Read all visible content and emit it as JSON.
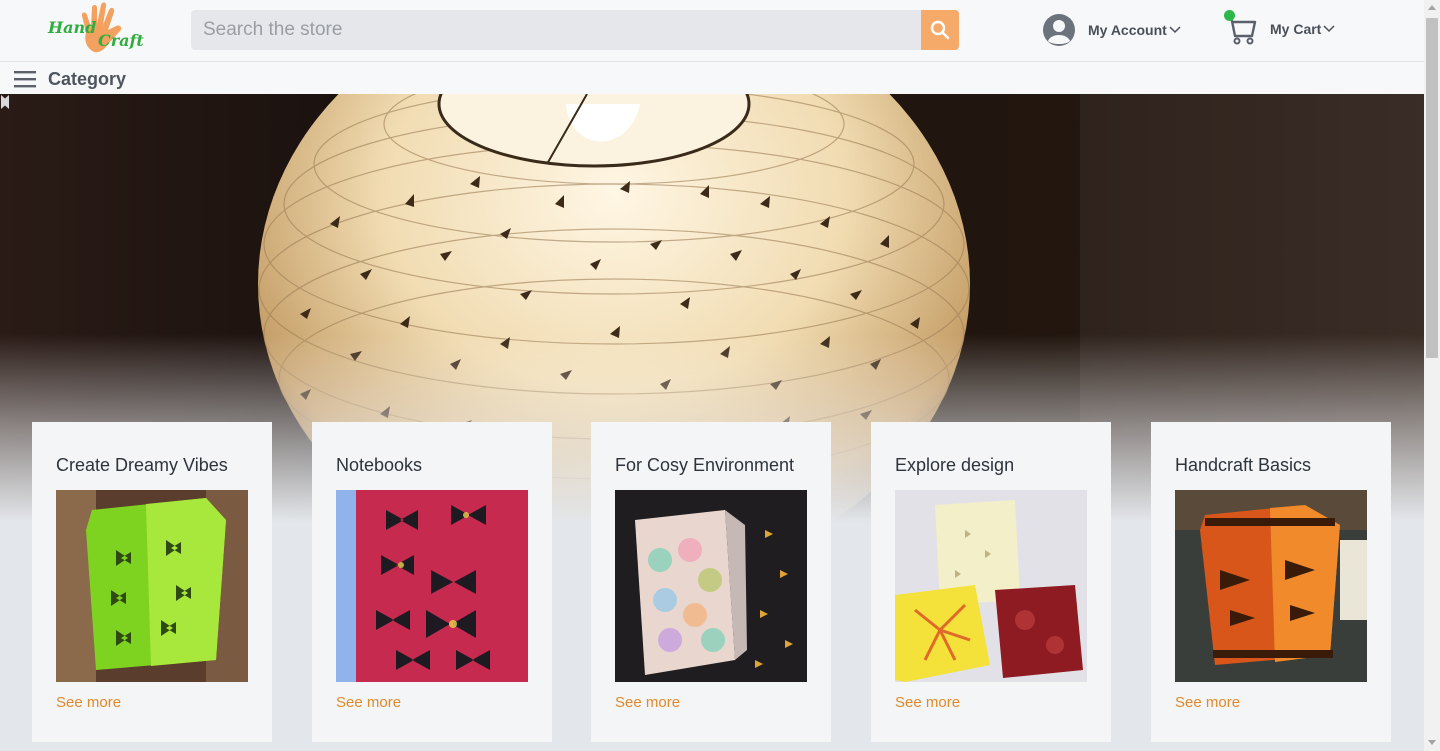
{
  "header": {
    "logo_text_1": "Hand",
    "logo_text_2": "Craft",
    "search_placeholder": "Search the store",
    "account_label": "My Account",
    "cart_label": "My Cart"
  },
  "category_bar": {
    "label": "Category"
  },
  "hero": {
    "image": "paper-lantern-photo"
  },
  "cards": [
    {
      "title": "Create Dreamy Vibes",
      "link": "See more",
      "image": "green-butterfly-lantern"
    },
    {
      "title": "Notebooks",
      "link": "See more",
      "image": "red-butterfly-notebook"
    },
    {
      "title": "For Cosy Environment",
      "link": "See more",
      "image": "pastel-leaf-lantern"
    },
    {
      "title": "Explore design",
      "link": "See more",
      "image": "handmade-notebooks"
    },
    {
      "title": "Handcraft Basics",
      "link": "See more",
      "image": "orange-fish-lantern"
    }
  ],
  "colors": {
    "accent": "#f5aa6a",
    "link": "#e08a2a",
    "cart_dot": "#2eb84b"
  }
}
